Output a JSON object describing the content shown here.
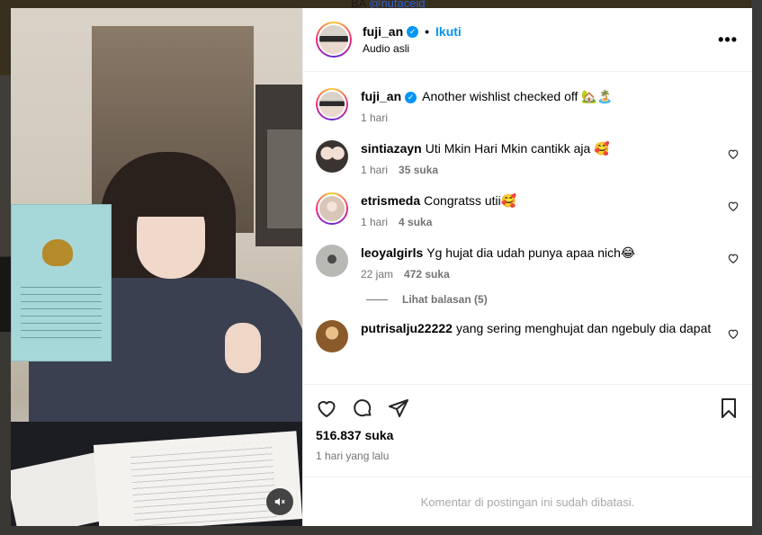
{
  "backdrop": {
    "text_prefix": "BA",
    "text_handle": "@nufaceid"
  },
  "post": {
    "username": "fuji_an",
    "verified_mark": "✓",
    "separator": "•",
    "follow_label": "Ikuti",
    "audio_label": "Audio asli",
    "more_label": "•••",
    "caption": {
      "username": "fuji_an",
      "text": "Another wishlist checked off 🏡🏝️",
      "time": "1 hari"
    },
    "comments": [
      {
        "username": "sintiazayn",
        "text": "Uti Mkin Hari Mkin cantikk aja 🥰",
        "time": "1 hari",
        "likes": "35 suka",
        "avatar_color": "#3b3330"
      },
      {
        "username": "etrismeda",
        "text": "Congratss utii🥰",
        "time": "1 hari",
        "likes": "4 suka",
        "avatar_color": "#e9d9cc"
      },
      {
        "username": "leoyalgirls",
        "text": "Yg hujat dia udah punya apaa nich😂",
        "time": "22 jam",
        "likes": "472 suka",
        "avatar_color": "#8a8a88"
      },
      {
        "username": "putrisalju22222",
        "text": "yang sering menghujat dan ngebuly dia dapat",
        "time": "",
        "likes": "",
        "avatar_color": "#b08a4a"
      }
    ],
    "view_replies_label": "Lihat balasan (5)",
    "likes_total": "516.837 suka",
    "time_ago": "1 hari yang lalu",
    "comments_closed": "Komentar di postingan ini sudah dibatasi."
  },
  "icons": {
    "like": "heart-icon",
    "comment": "comment-icon",
    "share": "share-icon",
    "save": "bookmark-icon",
    "mute": "speaker-muted-icon",
    "more": "more-options-icon"
  },
  "colors": {
    "accent": "#0095f6",
    "muted_text": "#737373",
    "verified": "#0095f6"
  }
}
